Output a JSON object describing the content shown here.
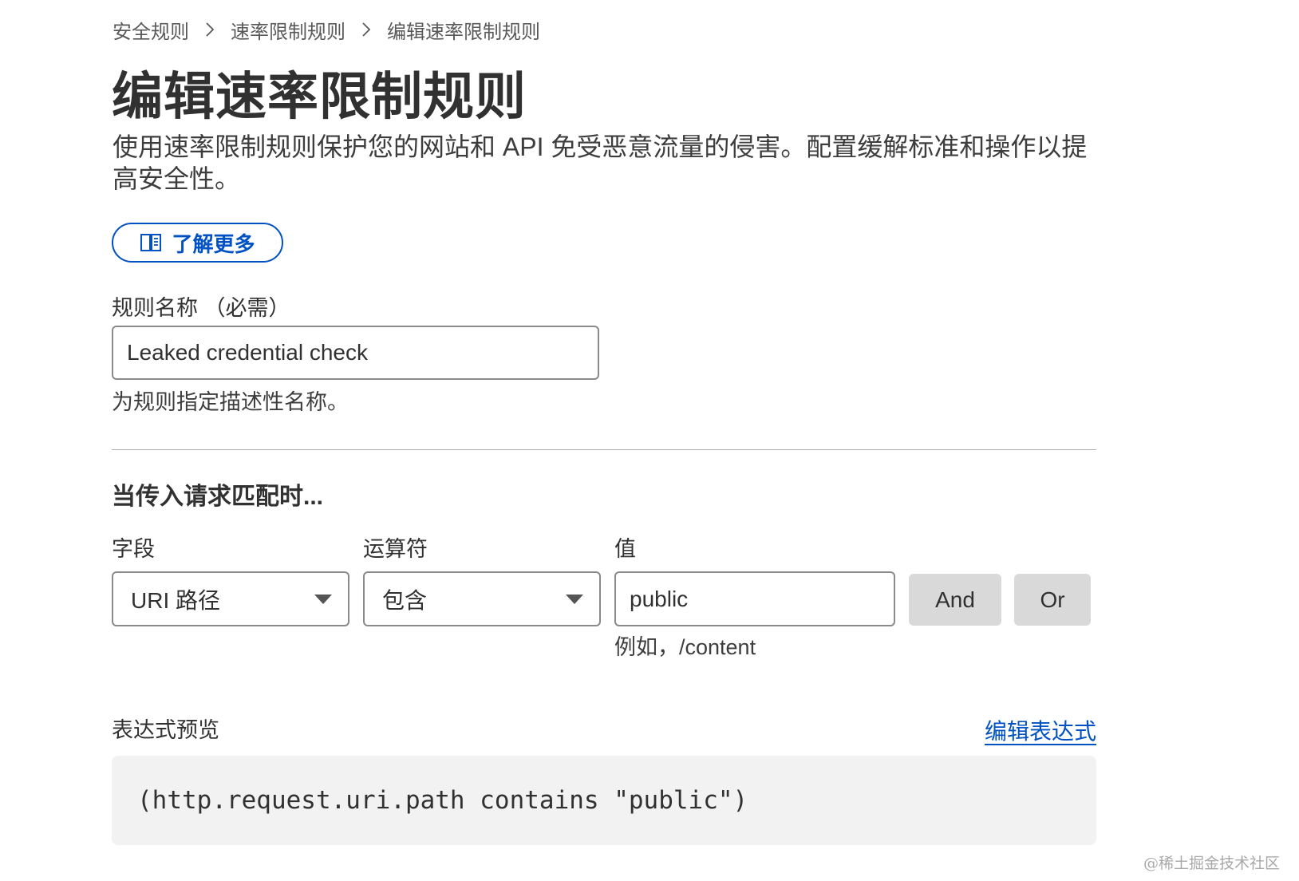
{
  "breadcrumb": {
    "items": [
      "安全规则",
      "速率限制规则",
      "编辑速率限制规则"
    ],
    "separator_icon": "chevron-right-icon"
  },
  "header": {
    "title": "编辑速率限制规则",
    "description": "使用速率限制规则保护您的网站和 API 免受恶意流量的侵害。配置缓解标准和操作以提高安全性。"
  },
  "learn_more": {
    "label": "了解更多",
    "icon": "book-icon"
  },
  "rule_name": {
    "label": "规则名称 （必需）",
    "value": "Leaked credential check",
    "helper": "为规则指定描述性名称。"
  },
  "match_section": {
    "title": "当传入请求匹配时...",
    "field": {
      "label": "字段",
      "value": "URI 路径"
    },
    "operator": {
      "label": "运算符",
      "value": "包含"
    },
    "value_input": {
      "label": "值",
      "value": "public",
      "helper": "例如，/content"
    },
    "and_button": "And",
    "or_button": "Or"
  },
  "expression_preview": {
    "label": "表达式预览",
    "edit_link": "编辑表达式",
    "code": "(http.request.uri.path contains \"public\")"
  },
  "watermark": "@稀土掘金技术社区",
  "colors": {
    "accent": "#0051c3",
    "input_border": "#8a8a8a",
    "button_gray": "#d9d9d9",
    "code_bg": "#f2f2f2"
  }
}
